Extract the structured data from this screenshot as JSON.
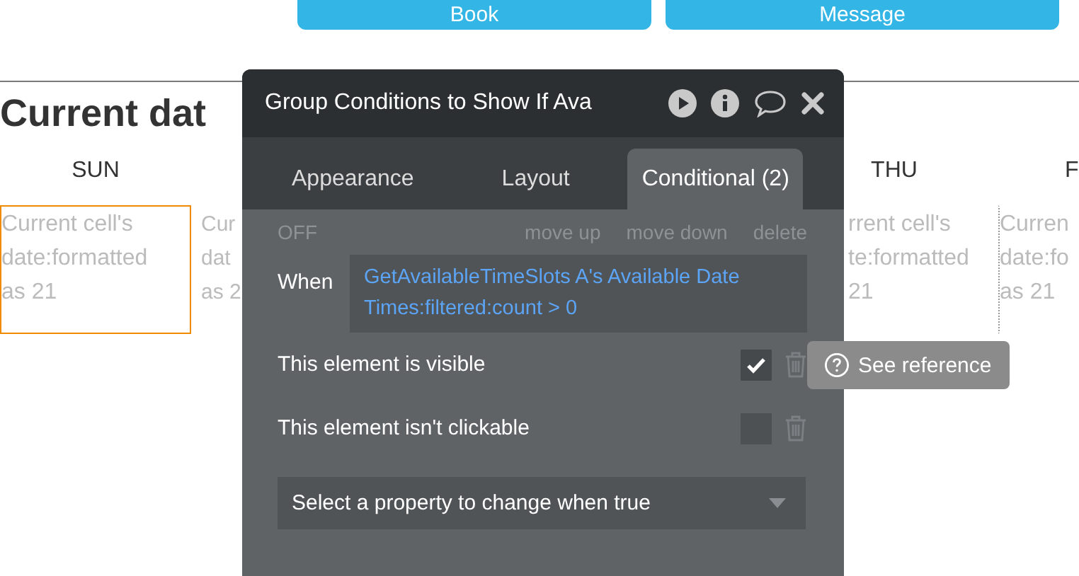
{
  "page": {
    "buttons": [
      "Book",
      "Message"
    ],
    "heading": "Current dat",
    "days": [
      {
        "label": "SUN"
      },
      {
        "label": "THU"
      },
      {
        "label": "F"
      }
    ],
    "cells": [
      {
        "lines": [
          "Current cell's",
          "date:formatted",
          "as 21"
        ],
        "selected": true
      },
      {
        "lines": [
          "Cur",
          "dat",
          "as 2"
        ],
        "selected": false
      },
      {
        "lines": [
          "rrent cell's",
          "te:formatted",
          "21"
        ],
        "selected": false
      },
      {
        "lines": [
          "Curren",
          "date:fo",
          "as 21"
        ],
        "selected": false
      }
    ]
  },
  "panel": {
    "title": "Group Conditions to Show If Ava",
    "tabs": [
      {
        "label": "Appearance",
        "selected": false
      },
      {
        "label": "Layout",
        "selected": false
      },
      {
        "label": "Conditional (2)",
        "selected": true
      }
    ],
    "condition": {
      "state": "OFF",
      "actions": [
        "move up",
        "move down",
        "delete"
      ],
      "when_label": "When",
      "expression": "GetAvailableTimeSlots A's Available Date Times:filtered:count > 0"
    },
    "properties": [
      {
        "label": "This element is visible",
        "checked": true
      },
      {
        "label": "This element isn't clickable",
        "checked": false
      }
    ],
    "select": {
      "placeholder": "Select a property to change when true"
    }
  },
  "tooltip": {
    "text": "See reference"
  }
}
